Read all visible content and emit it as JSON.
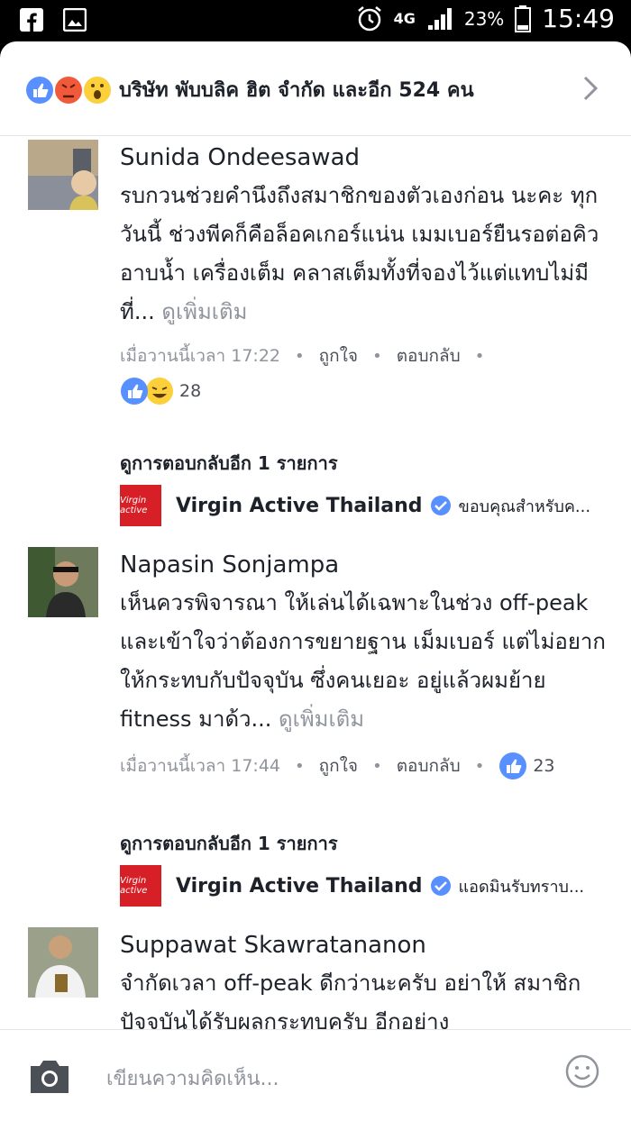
{
  "status_bar": {
    "network": "4G",
    "battery": "23%",
    "time": "15:49"
  },
  "reactions_header": {
    "summary": "บริษัท พับบลิค ฮิต จำกัด และอีก 524 คน"
  },
  "comments": [
    {
      "name": "Sunida Ondeesawad",
      "text": "รบกวนช่วยคำนึงถึงสมาชิกของตัวเองก่อน นะคะ ทุกวันนี้ ช่วงพีคก็คือล็อคเกอร์แน่น เมมเบอร์ยืนรอต่อคิวอาบน้ำ เครื่องเต็ม คลาสเต็มทั้งที่จองไว้แต่แทบไม่มีที่...",
      "more": "ดูเพิ่มเติม",
      "time": "เมื่อวานนี้เวลา 17:22",
      "like": "ถูกใจ",
      "reply": "ตอบกลับ",
      "reaction_count": "28",
      "view_more_replies": "ดูการตอบกลับอีก 1 รายการ",
      "reply_preview": {
        "name": "Virgin Active Thailand",
        "text": "ขอบคุณสำหรับค..."
      }
    },
    {
      "name": "Napasin Sonjampa",
      "text": "เห็นควรพิจารณา ให้เล่นได้เฉพาะในช่วง off-peak และเข้าใจว่าต้องการขยายฐาน เม็มเบอร์ แต่ไม่อยากให้กระทบกับปัจจุบัน ซึ่งคนเยอะ อยู่แล้วผมย้าย fitness มาด้ว...",
      "more": "ดูเพิ่มเติม",
      "time": "เมื่อวานนี้เวลา 17:44",
      "like": "ถูกใจ",
      "reply": "ตอบกลับ",
      "reaction_count": "23",
      "view_more_replies": "ดูการตอบกลับอีก 1 รายการ",
      "reply_preview": {
        "name": "Virgin Active Thailand",
        "text": "แอดมินรับทราบ..."
      }
    },
    {
      "name": "Suppawat Skawratananon",
      "text": "จำกัดเวลา off-peak ดีกว่านะครับ อย่าให้ สมาชิกปัจจุบันได้รับผลกระทบครับ อีกอย่าง"
    }
  ],
  "composer": {
    "placeholder": "เขียนความคิดเห็น..."
  },
  "colors": {
    "like_blue": "#5890ff",
    "angry": "#f05a3a",
    "wow": "#fcd03a",
    "brand_red": "#d61f26"
  }
}
